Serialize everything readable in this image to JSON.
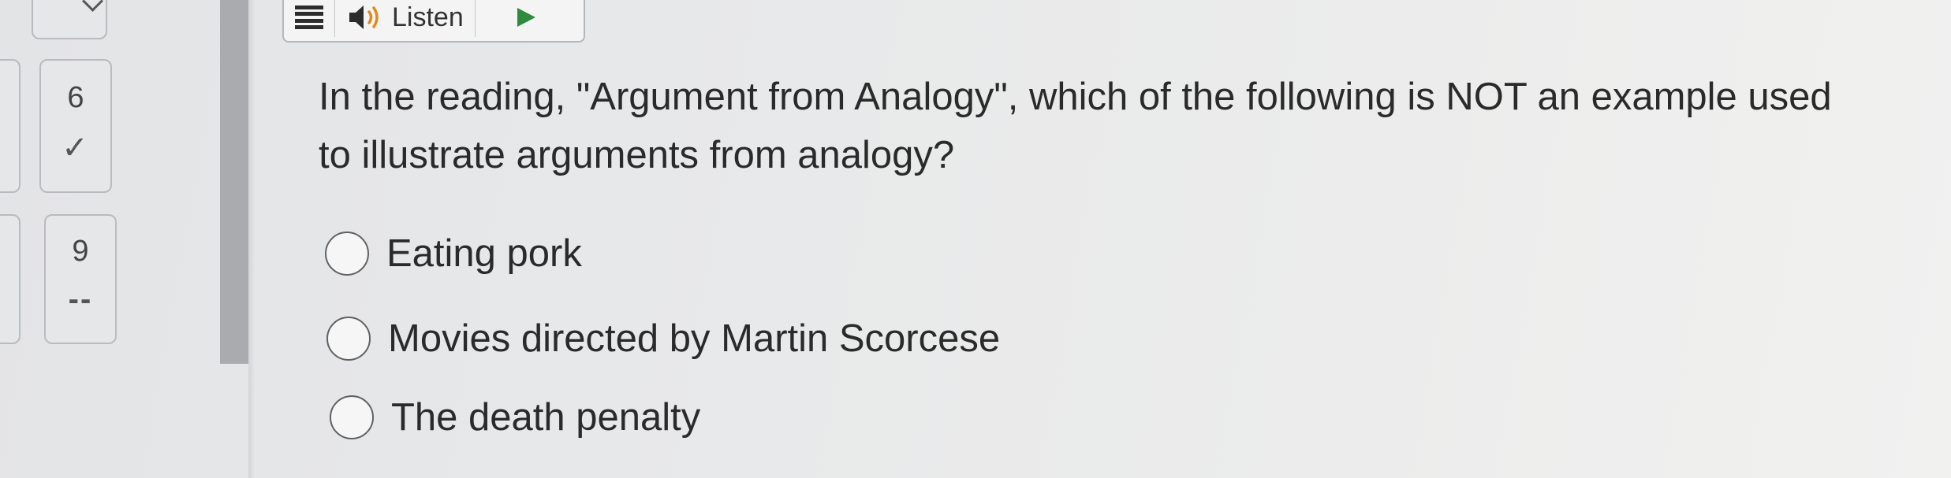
{
  "toolbar": {
    "listen_label": "Listen",
    "icons": [
      "menu-icon",
      "speaker-icon",
      "play-icon"
    ]
  },
  "navigator": {
    "items": [
      {
        "number": "6",
        "status": "✓",
        "status_meaning": "answered"
      },
      {
        "number": "9",
        "status": "--",
        "status_meaning": "unanswered"
      }
    ]
  },
  "question": {
    "text": "In the reading, \"Argument from Analogy\", which of the following is NOT an example used to illustrate arguments from analogy?",
    "options": [
      {
        "label": "Eating pork",
        "selected": false
      },
      {
        "label": "Movies directed by Martin Scorcese",
        "selected": false
      },
      {
        "label": "The death penalty",
        "selected": false
      }
    ]
  },
  "colors": {
    "background": "#e8e9ea",
    "divider": "#a9abae",
    "text": "#2a2a2a"
  }
}
